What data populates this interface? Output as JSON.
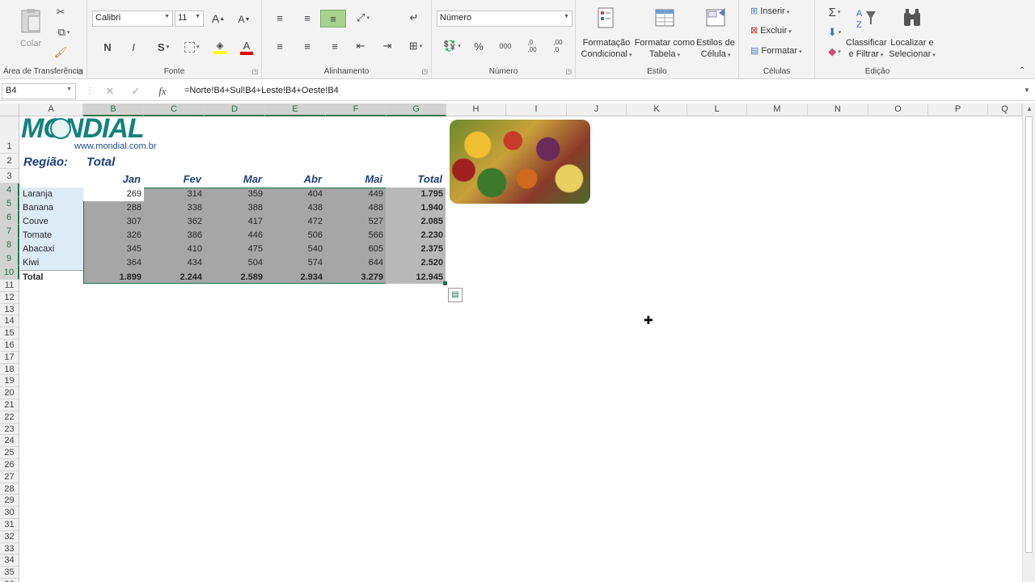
{
  "ribbon": {
    "clipboard": {
      "label": "Área de Transferência",
      "paste": "Colar"
    },
    "font": {
      "label": "Fonte",
      "name": "Calibri",
      "size": "11",
      "bold": "N",
      "italic": "I",
      "underline": "S",
      "grow": "A",
      "shrink": "A",
      "color_letter": "A"
    },
    "alignment": {
      "label": "Alinhamento"
    },
    "number": {
      "label": "Número",
      "format": "Número",
      "percent": "%",
      "thousands": "000",
      "inc_decimal": ",0\n,00",
      "dec_decimal": ",00\n,0"
    },
    "styles": {
      "label": "Estilo",
      "conditional": "Formatação\nCondicional",
      "table": "Formatar como\nTabela",
      "cell": "Estilos de\nCélula"
    },
    "cells": {
      "label": "Células",
      "insert": "Inserir",
      "delete": "Excluir",
      "format": "Formatar"
    },
    "editing": {
      "label": "Edição",
      "sort": "Classificar\ne Filtrar",
      "find": "Localizar e\nSelecionar"
    }
  },
  "formula_bar": {
    "name_box": "B4",
    "cancel": "✕",
    "enter": "✓",
    "fx": "fx",
    "formula": "=Norte!B4+Sul!B4+Leste!B4+Oeste!B4"
  },
  "columns": [
    "A",
    "B",
    "C",
    "D",
    "E",
    "F",
    "G",
    "H",
    "I",
    "J",
    "K",
    "L",
    "M",
    "N",
    "O",
    "P",
    "Q"
  ],
  "rows": [
    "1",
    "2",
    "3",
    "4",
    "5",
    "6",
    "7",
    "8",
    "9",
    "10",
    "11",
    "12",
    "13",
    "14",
    "15",
    "16",
    "17",
    "18",
    "19",
    "20",
    "21",
    "22",
    "23",
    "24",
    "25",
    "26",
    "27",
    "28",
    "29",
    "30",
    "31",
    "32",
    "33",
    "34",
    "35",
    "36"
  ],
  "sheet": {
    "logo_text": "MONDIAL",
    "logo_url": "www.mondial.com.br",
    "region_label": "Região:",
    "region_value": "Total",
    "headers": [
      "Jan",
      "Fev",
      "Mar",
      "Abr",
      "Mai",
      "Total"
    ],
    "data": [
      {
        "name": "Laranja",
        "values": [
          "269",
          "314",
          "359",
          "404",
          "449",
          "1.795"
        ]
      },
      {
        "name": "Banana",
        "values": [
          "288",
          "338",
          "388",
          "438",
          "488",
          "1.940"
        ]
      },
      {
        "name": "Couve",
        "values": [
          "307",
          "362",
          "417",
          "472",
          "527",
          "2.085"
        ]
      },
      {
        "name": "Tomate",
        "values": [
          "326",
          "386",
          "446",
          "506",
          "566",
          "2.230"
        ]
      },
      {
        "name": "Abacaxi",
        "values": [
          "345",
          "410",
          "475",
          "540",
          "605",
          "2.375"
        ]
      },
      {
        "name": "Kiwi",
        "values": [
          "364",
          "434",
          "504",
          "574",
          "644",
          "2.520"
        ]
      }
    ],
    "total_row": {
      "name": "Total",
      "values": [
        "1.899",
        "2.244",
        "2.589",
        "2.934",
        "3.279",
        "12.945"
      ]
    }
  },
  "colors": {
    "excel_green": "#217346",
    "selection_gray": "#a6a6a6",
    "header_blue": "#1f3f7a",
    "logo_teal": "#13827c"
  }
}
